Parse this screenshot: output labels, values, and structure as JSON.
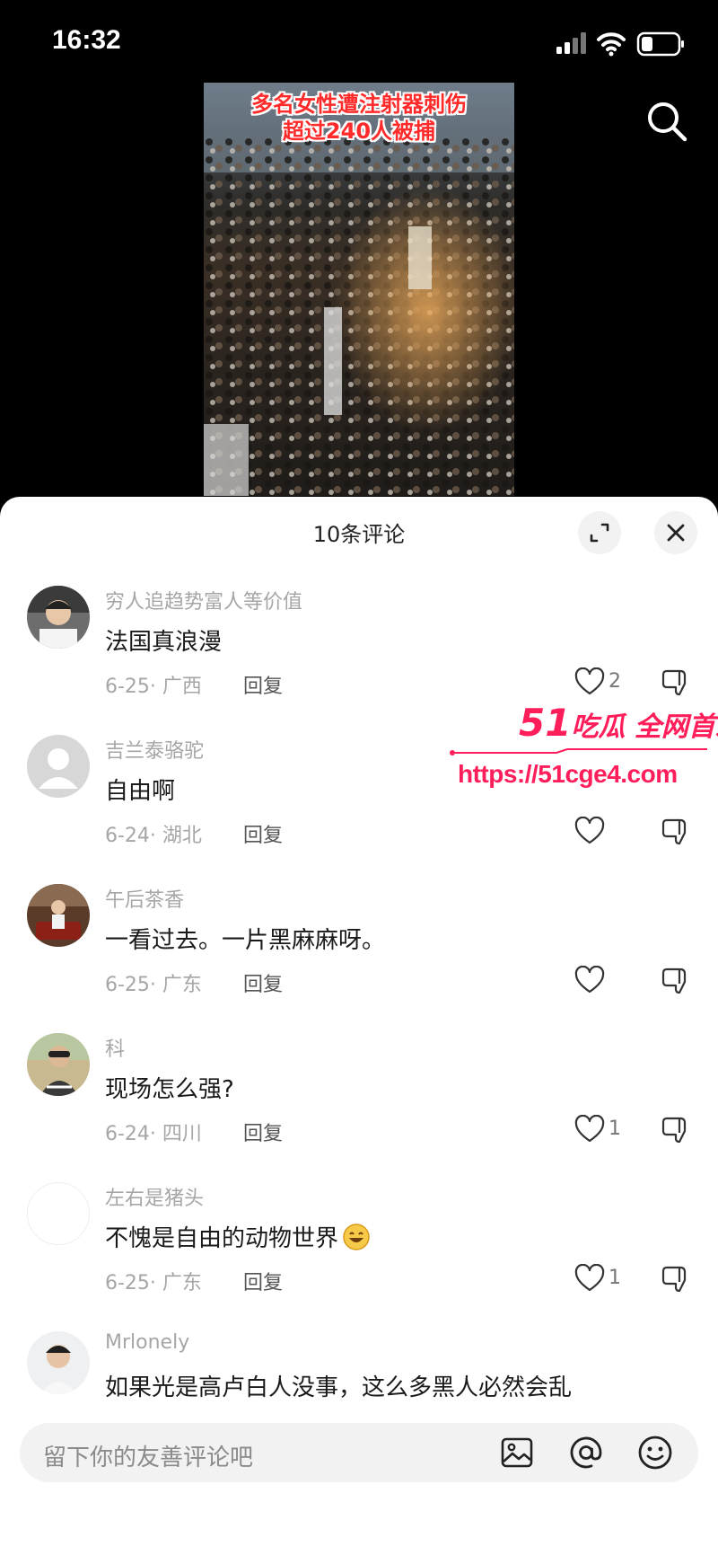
{
  "status_bar": {
    "time": "16:32",
    "icons": [
      "signal-icon",
      "wifi-icon",
      "battery-icon"
    ]
  },
  "video": {
    "caption_line1": "多名女性遭注射器刺伤",
    "caption_line2": "超过240人被捕"
  },
  "sheet": {
    "title": "10条评论"
  },
  "comments": [
    {
      "username": "穷人追趋势富人等价值",
      "text": "法国真浪漫",
      "meta": "6-25· 广西",
      "reply": "回复",
      "likes": "2"
    },
    {
      "username": "吉兰泰骆驼",
      "text": "自由啊",
      "meta": "6-24· 湖北",
      "reply": "回复",
      "likes": ""
    },
    {
      "username": "午后茶香",
      "text": "一看过去。一片黑麻麻呀。",
      "meta": "6-25· 广东",
      "reply": "回复",
      "likes": ""
    },
    {
      "username": "科",
      "text": "现场怎么强?",
      "meta": "6-24· 四川",
      "reply": "回复",
      "likes": "1"
    },
    {
      "username": "左右是猪头",
      "text": "不愧是自由的动物世界",
      "meta": "6-25· 广东",
      "reply": "回复",
      "likes": "1"
    },
    {
      "username": "Mrlonely",
      "text": "如果光是高卢白人没事，这么多黑人必然会乱",
      "meta": "",
      "reply": "",
      "likes": ""
    }
  ],
  "watermark": {
    "brand_num": "51",
    "brand_text": "吃瓜 全网首发",
    "url": "https://51cge4.com"
  },
  "input": {
    "placeholder": "留下你的友善评论吧"
  },
  "colors": {
    "accent": "#ff1e5a",
    "muted": "#a6a6a6"
  }
}
